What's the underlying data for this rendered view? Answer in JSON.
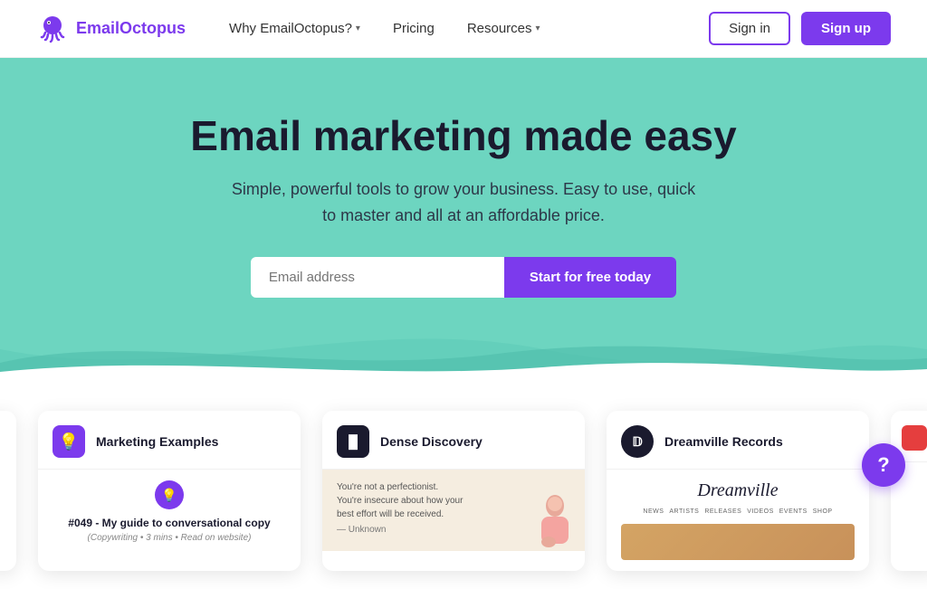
{
  "brand": {
    "name": "EmailOctopus",
    "logo_color": "#7c3aed"
  },
  "nav": {
    "links": [
      {
        "label": "Why EmailOctopus?",
        "has_dropdown": true
      },
      {
        "label": "Pricing",
        "has_dropdown": false
      },
      {
        "label": "Resources",
        "has_dropdown": true
      }
    ],
    "signin_label": "Sign in",
    "signup_label": "Sign up"
  },
  "hero": {
    "headline": "Email marketing made easy",
    "subheadline": "Simple, powerful tools to grow your business. Easy to use, quick to master and all at an affordable price.",
    "email_placeholder": "Email address",
    "cta_label": "Start for free today"
  },
  "cards": [
    {
      "id": "marketing-examples",
      "title": "Marketing Examples",
      "icon_type": "bulb",
      "article_title": "#049 - My guide to conversational copy",
      "article_meta": "(Copywriting • 3 mins • Read on website)"
    },
    {
      "id": "dense-discovery",
      "title": "Dense Discovery",
      "icon_text": "DD",
      "quote_text": "You're not a perfectionist. You're insecure about how your best effort will be received.",
      "quote_attr": "— Unknown"
    },
    {
      "id": "dreamville-records",
      "title": "Dreamville Records",
      "icon_text": "D",
      "logo_text": "Dreamville",
      "nav_items": [
        "NEWS",
        "ARTISTS",
        "RELEASES",
        "VIDEOS",
        "EVENTS",
        "SHOP"
      ]
    }
  ],
  "help_button_label": "?"
}
